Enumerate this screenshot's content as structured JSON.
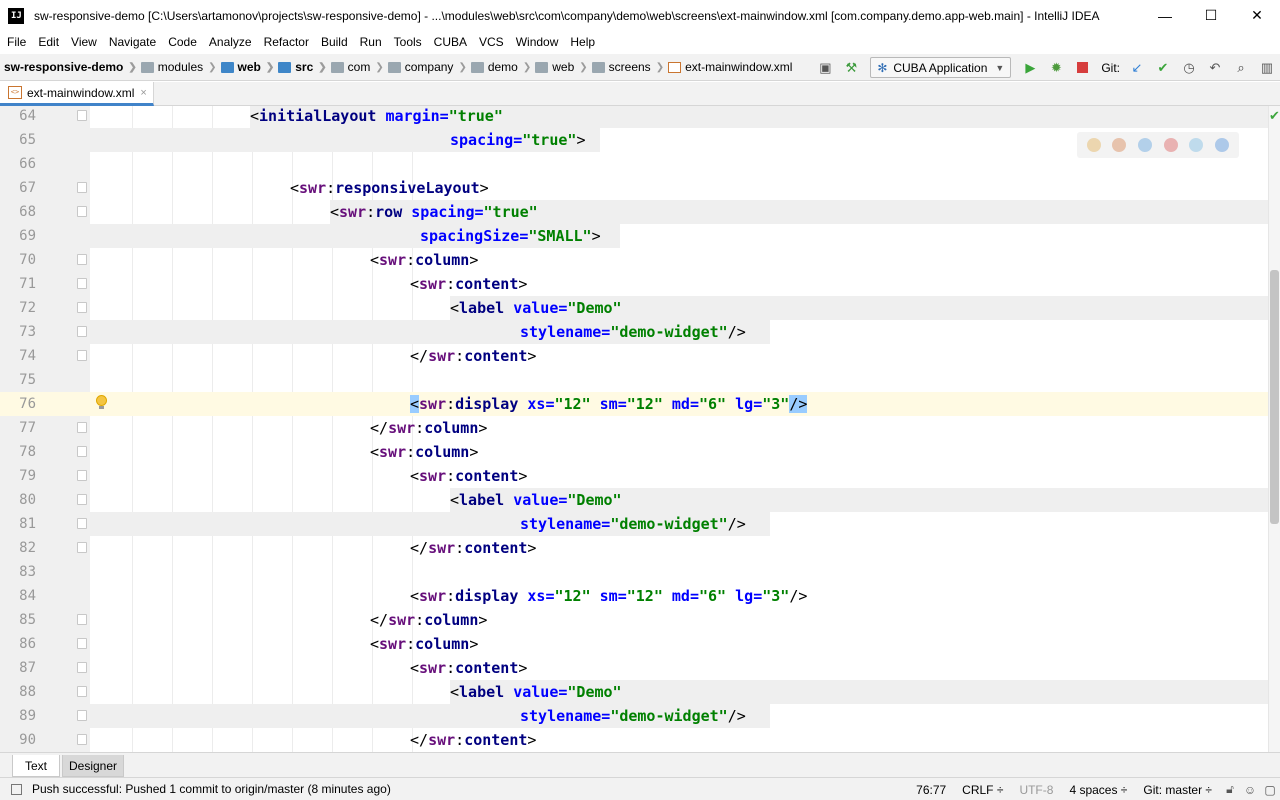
{
  "window": {
    "title": "sw-responsive-demo [C:\\Users\\artamonov\\projects\\sw-responsive-demo] - ...\\modules\\web\\src\\com\\company\\demo\\web\\screens\\ext-mainwindow.xml [com.company.demo.app-web.main] - IntelliJ IDEA",
    "minimize": "—",
    "maximize": "☐",
    "close": "✕"
  },
  "menu": [
    "File",
    "Edit",
    "View",
    "Navigate",
    "Code",
    "Analyze",
    "Refactor",
    "Build",
    "Run",
    "Tools",
    "CUBA",
    "VCS",
    "Window",
    "Help"
  ],
  "breadcrumbs": [
    {
      "label": "sw-responsive-demo",
      "icon": "project-folder-icon",
      "bold": true
    },
    {
      "label": "modules",
      "icon": "folder-icon"
    },
    {
      "label": "web",
      "icon": "module-folder-icon",
      "bold": true
    },
    {
      "label": "src",
      "icon": "source-folder-icon",
      "bold": true
    },
    {
      "label": "com",
      "icon": "folder-icon"
    },
    {
      "label": "company",
      "icon": "folder-icon"
    },
    {
      "label": "demo",
      "icon": "folder-icon"
    },
    {
      "label": "web",
      "icon": "folder-icon"
    },
    {
      "label": "screens",
      "icon": "folder-icon"
    },
    {
      "label": "ext-mainwindow.xml",
      "icon": "xml-file-icon"
    }
  ],
  "toolbar": {
    "run_config": "CUBA Application",
    "git_label": "Git:"
  },
  "editor_tab": {
    "label": "ext-mainwindow.xml",
    "close": "×"
  },
  "code_lines": [
    {
      "num": "64"
    },
    {
      "num": "65"
    },
    {
      "num": "66"
    },
    {
      "num": "67"
    },
    {
      "num": "68"
    },
    {
      "num": "69"
    },
    {
      "num": "70"
    },
    {
      "num": "71"
    },
    {
      "num": "72"
    },
    {
      "num": "73"
    },
    {
      "num": "74"
    },
    {
      "num": "75"
    },
    {
      "num": "76"
    },
    {
      "num": "77"
    },
    {
      "num": "78"
    },
    {
      "num": "79"
    },
    {
      "num": "80"
    },
    {
      "num": "81"
    },
    {
      "num": "82"
    },
    {
      "num": "83"
    },
    {
      "num": "84"
    },
    {
      "num": "85"
    },
    {
      "num": "86"
    },
    {
      "num": "87"
    },
    {
      "num": "88"
    },
    {
      "num": "89"
    },
    {
      "num": "90"
    }
  ],
  "bottom_tabs": {
    "text": "Text",
    "designer": "Designer"
  },
  "status": {
    "message": "Push successful: Pushed 1 commit to origin/master (8 minutes ago)",
    "position": "76:77",
    "line_separator": "CRLF ÷",
    "encoding": "UTF-8",
    "indent": "4 spaces ÷",
    "git_branch": "Git: master ÷"
  },
  "colors": {
    "tag": "#000080",
    "namespace": "#660e7a",
    "attribute": "#0000ff",
    "value": "#008000",
    "current_line": "#fffae3",
    "tab_underline": "#4083c9"
  }
}
